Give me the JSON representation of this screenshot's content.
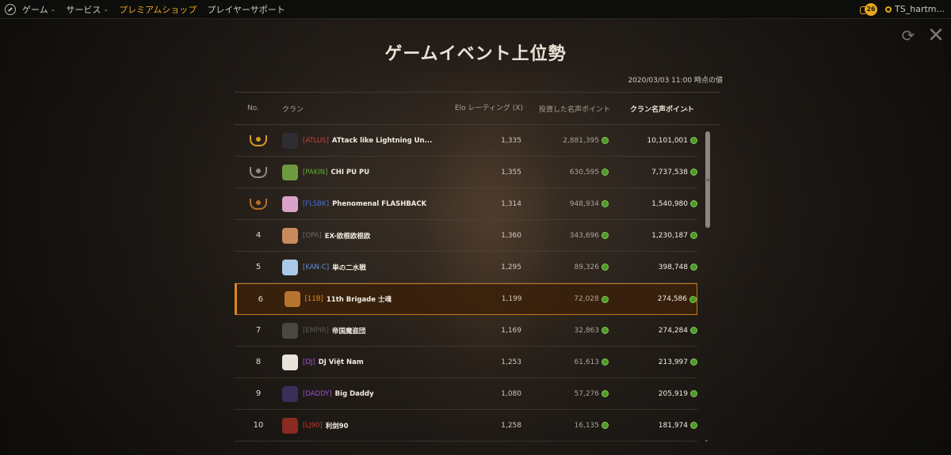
{
  "topbar": {
    "nav": [
      {
        "label": "ゲーム",
        "has_dropdown": true,
        "active": false
      },
      {
        "label": "サービス",
        "has_dropdown": true,
        "active": false
      },
      {
        "label": "プレミアムショップ",
        "has_dropdown": false,
        "active": true
      },
      {
        "label": "プレイヤーサポート",
        "has_dropdown": false,
        "active": false
      }
    ],
    "notification_count": "26",
    "username": "TS_hartm..."
  },
  "page": {
    "title": "ゲームイベント上位勢",
    "timestamp": "2020/03/03 11:00 時点の値"
  },
  "table": {
    "headers": {
      "no": "No.",
      "clan": "クラン",
      "elo": "Elo レーティング (X)",
      "invested": "投資した名声ポイント",
      "clan_points": "クラン名声ポイント"
    },
    "rows": [
      {
        "rank": "1",
        "medal": "gold",
        "tag": "[ATLUS]",
        "tag_color": "#c9423a",
        "name": "ATtack like Lightning Un...",
        "elo": "1,335",
        "invested": "2,881,395",
        "points": "10,101,001",
        "emblem_color": "#2d2d33",
        "highlight": false
      },
      {
        "rank": "2",
        "medal": "silver",
        "tag": "[PAKIN]",
        "tag_color": "#5fae3a",
        "name": "CHI PU PU",
        "elo": "1,355",
        "invested": "630,595",
        "points": "7,737,538",
        "emblem_color": "#6d9a3f",
        "highlight": false
      },
      {
        "rank": "3",
        "medal": "bronze",
        "tag": "[FLSBK]",
        "tag_color": "#4b6fd6",
        "name": "Phenomenal FLASHBACK",
        "elo": "1,314",
        "invested": "948,934",
        "points": "1,540,980",
        "emblem_color": "#d9a3c9",
        "highlight": false
      },
      {
        "rank": "4",
        "medal": "",
        "tag": "[OPA]",
        "tag_color": "#6e6a64",
        "name": "EX-欧根欧根欧",
        "elo": "1,360",
        "invested": "343,696",
        "points": "1,230,187",
        "emblem_color": "#c98a5e",
        "highlight": false
      },
      {
        "rank": "5",
        "medal": "",
        "tag": "[KAN-C]",
        "tag_color": "#5f8fe0",
        "name": "単の二水戦",
        "elo": "1,295",
        "invested": "89,326",
        "points": "398,748",
        "emblem_color": "#a9c9e6",
        "highlight": false
      },
      {
        "rank": "6",
        "medal": "",
        "tag": "[11B]",
        "tag_color": "#e08a2a",
        "name": "11th Brigade 士魂",
        "elo": "1,199",
        "invested": "72,028",
        "points": "274,586",
        "emblem_color": "#b8742e",
        "highlight": true
      },
      {
        "rank": "7",
        "medal": "",
        "tag": "[EMPIR]",
        "tag_color": "#5a5650",
        "name": "帝国魔盗団",
        "elo": "1,169",
        "invested": "32,863",
        "points": "274,284",
        "emblem_color": "#4a4641",
        "highlight": false
      },
      {
        "rank": "8",
        "medal": "",
        "tag": "[DJ]",
        "tag_color": "#a857d6",
        "name": "DJ Việt Nam",
        "elo": "1,253",
        "invested": "61,613",
        "points": "213,997",
        "emblem_color": "#e8e4dc",
        "highlight": false
      },
      {
        "rank": "9",
        "medal": "",
        "tag": "[DADDY]",
        "tag_color": "#9a55d0",
        "name": "Big Daddy",
        "elo": "1,080",
        "invested": "57,276",
        "points": "205,919",
        "emblem_color": "#3a2f5a",
        "highlight": false
      },
      {
        "rank": "10",
        "medal": "",
        "tag": "[LJ90]",
        "tag_color": "#c93a32",
        "name": "利剑90",
        "elo": "1,258",
        "invested": "16,135",
        "points": "181,974",
        "emblem_color": "#8a2a22",
        "highlight": false
      }
    ]
  }
}
